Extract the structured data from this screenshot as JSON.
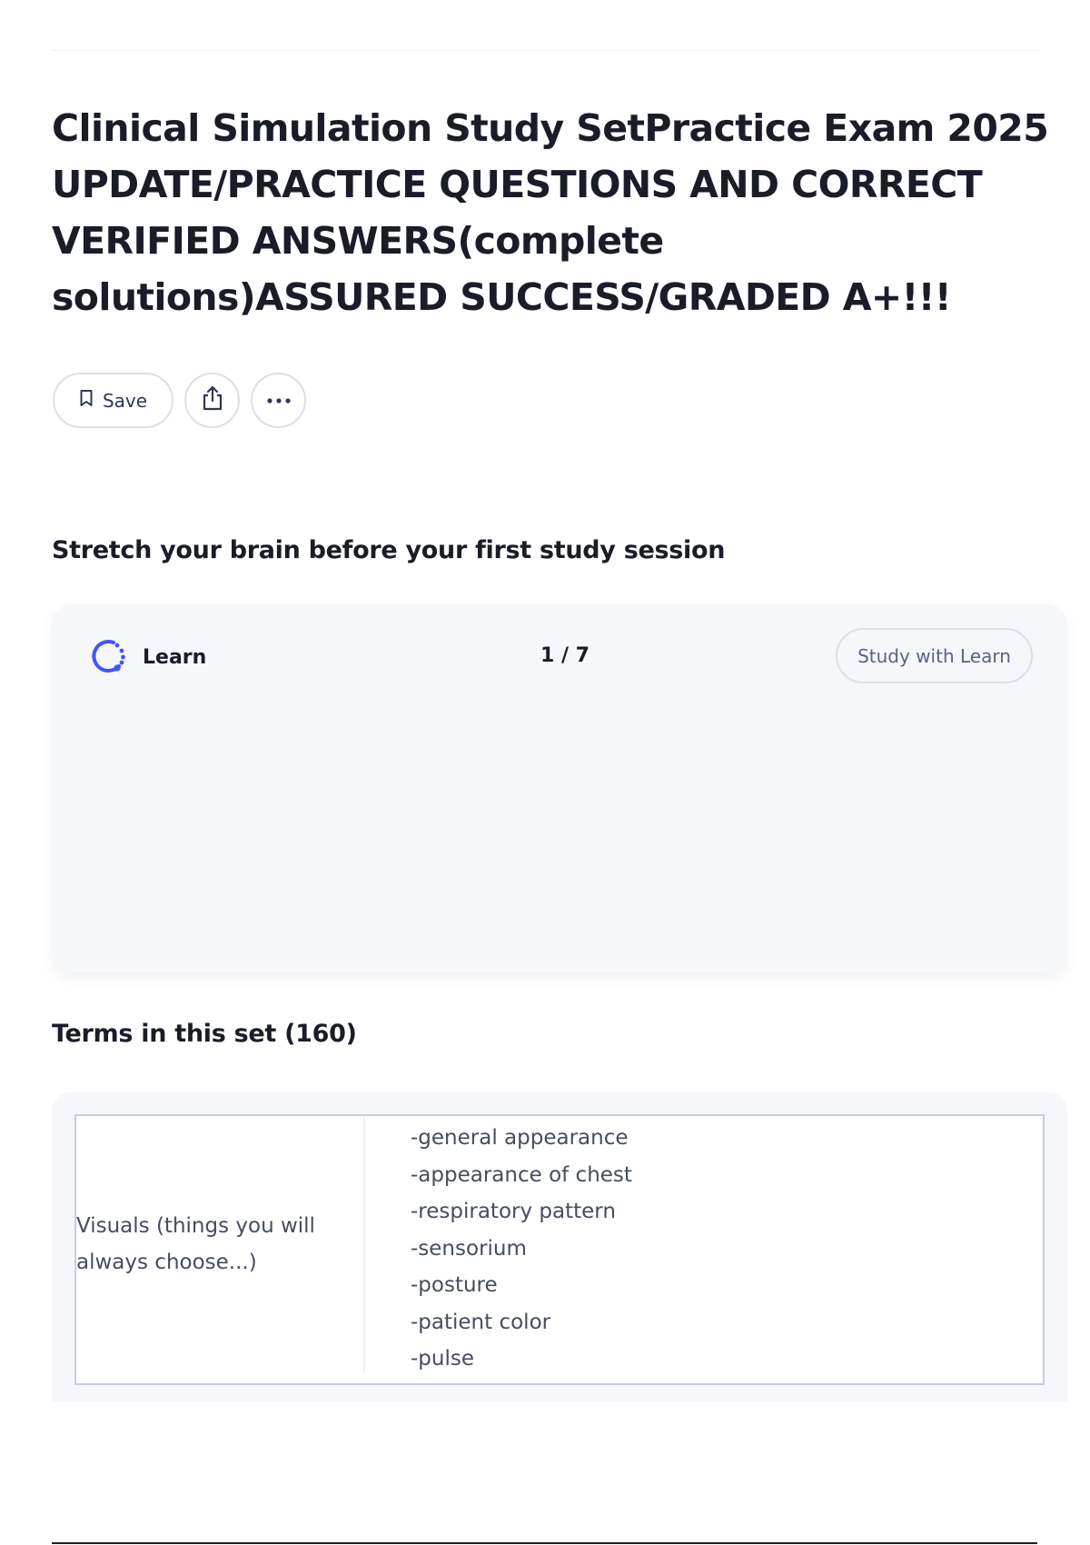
{
  "page": {
    "title": "Clinical Simulation Study SetPractice Exam 2025 UPDATE/PRACTICE QUESTIONS AND CORRECT VERIFIED ANSWERS(complete solutions)ASSURED SUCCESS/GRADED A+!!!"
  },
  "actions": {
    "save_label": "Save",
    "save_icon": "bookmark-icon",
    "share_icon": "share-icon",
    "more_icon": "more-horizontal-icon"
  },
  "learn_section": {
    "heading": "Stretch your brain before your first study session",
    "mode_label": "Learn",
    "mode_icon": "learn-icon",
    "progress": "1 / 7",
    "study_button_label": "Study with Learn"
  },
  "terms_section": {
    "heading": "Terms in this set (160)",
    "terms": [
      {
        "term": "Visuals (things you will always choose...)",
        "definition": [
          "-general appearance",
          "-appearance of chest",
          "-respiratory pattern",
          "-sensorium",
          "-posture",
          "-patient color",
          "-pulse"
        ]
      }
    ]
  },
  "colors": {
    "text_primary": "#1a1d28",
    "text_secondary": "#586380",
    "card_background": "#f6f7fb",
    "border": "#dcdfe8",
    "accent": "#4255ff"
  }
}
